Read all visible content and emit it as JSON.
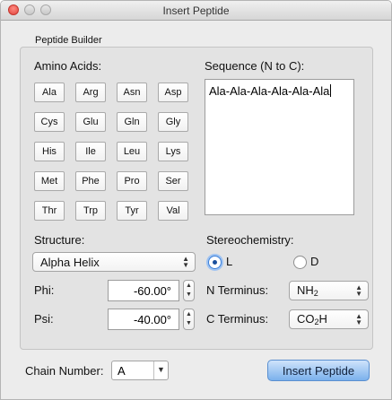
{
  "window": {
    "title": "Insert Peptide"
  },
  "group_label": "Peptide Builder",
  "amino_acids": {
    "label": "Amino Acids:",
    "buttons": [
      "Ala",
      "Arg",
      "Asn",
      "Asp",
      "Cys",
      "Glu",
      "Gln",
      "Gly",
      "His",
      "Ile",
      "Leu",
      "Lys",
      "Met",
      "Phe",
      "Pro",
      "Ser",
      "Thr",
      "Trp",
      "Tyr",
      "Val"
    ]
  },
  "sequence": {
    "label": "Sequence (N to C):",
    "value": "Ala-Ala-Ala-Ala-Ala-Ala"
  },
  "structure": {
    "label": "Structure:",
    "selected": "Alpha Helix"
  },
  "angles": {
    "phi_label": "Phi:",
    "phi_value": "-60.00°",
    "psi_label": "Psi:",
    "psi_value": "-40.00°"
  },
  "stereochemistry": {
    "label": "Stereochemistry:",
    "option_l": "L",
    "option_d": "D",
    "selected": "L"
  },
  "termini": {
    "n_label": "N Terminus:",
    "n_base": "NH",
    "n_sub": "2",
    "c_label": "C Terminus:",
    "c_pre": "CO",
    "c_sub": "2",
    "c_post": "H"
  },
  "chain": {
    "label": "Chain Number:",
    "value": "A"
  },
  "insert_button": "Insert Peptide",
  "colors": {
    "accent": "#7bb1ec",
    "close": "#e0443e"
  }
}
